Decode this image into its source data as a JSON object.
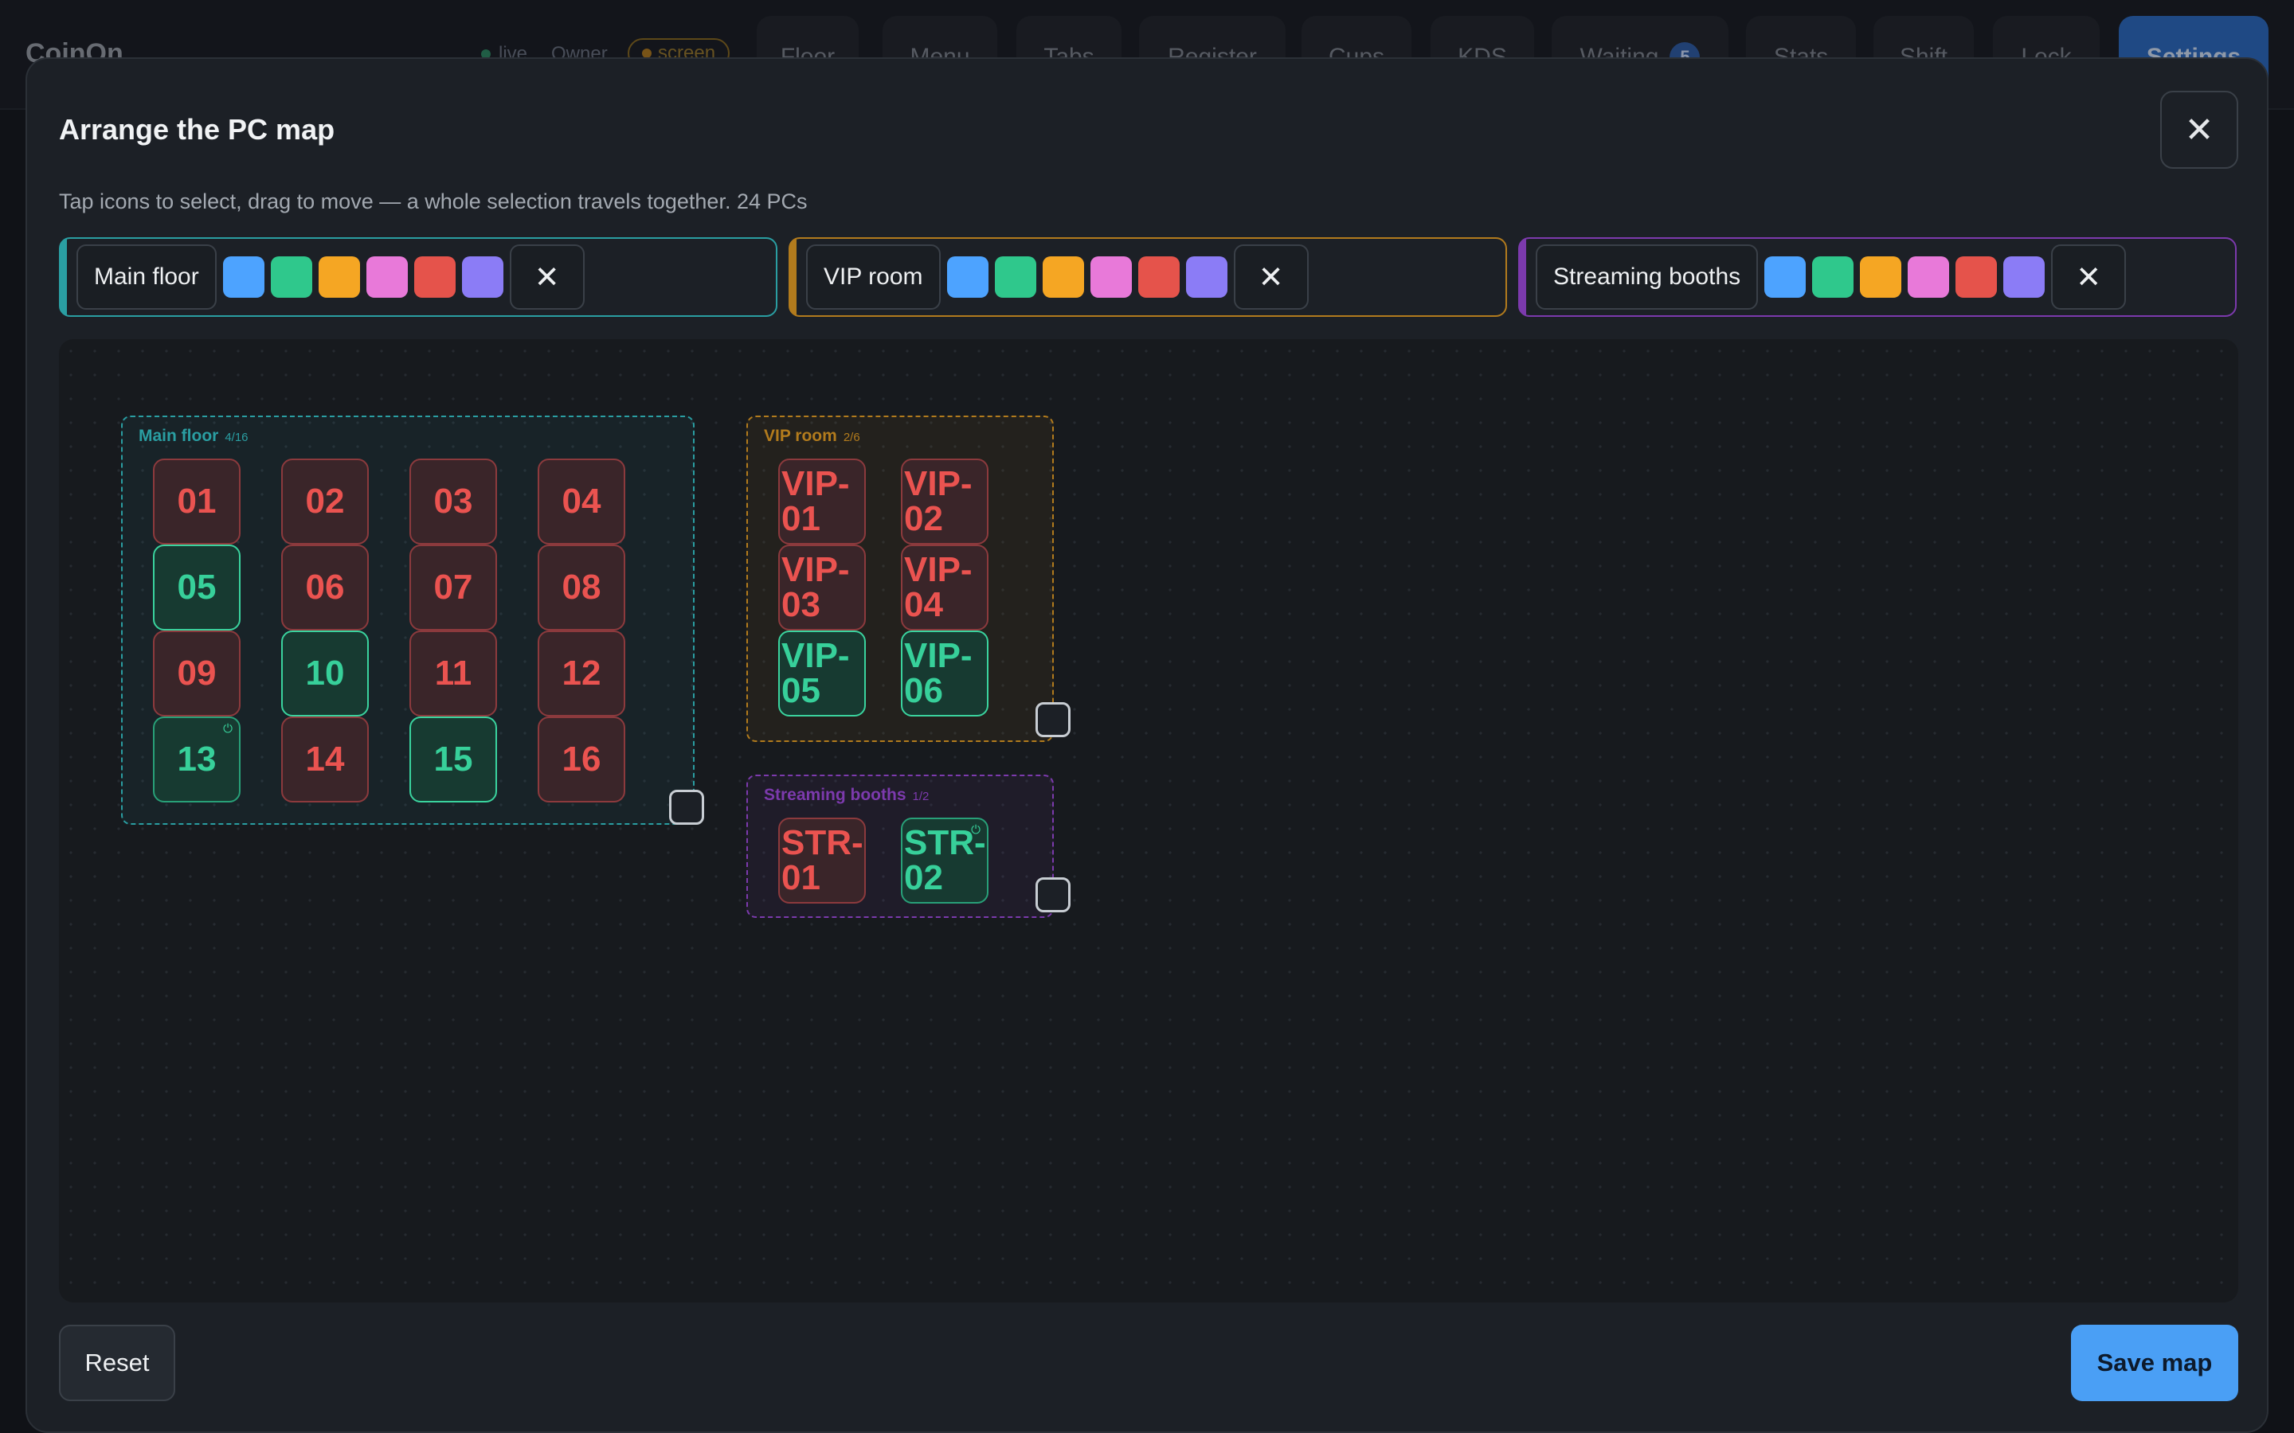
{
  "app": {
    "brand": "CoinOn",
    "status_live": "live",
    "role": "Owner",
    "screen_badge": "screen",
    "nav": [
      {
        "label": "Floor"
      },
      {
        "label": "Menu"
      },
      {
        "label": "Tabs"
      },
      {
        "label": "Register"
      },
      {
        "label": "Cups"
      },
      {
        "label": "KDS"
      },
      {
        "label": "Waiting",
        "badge": "5"
      },
      {
        "label": "Stats"
      },
      {
        "label": "Shift"
      },
      {
        "label": "Lock"
      },
      {
        "label": "Settings",
        "primary": true
      }
    ]
  },
  "modal": {
    "title": "Arrange the PC map",
    "subtitle": "Tap icons to select, drag to move — a whole selection travels together. 24 PCs",
    "close_icon": "close-icon",
    "reset_label": "Reset",
    "save_label": "Save map"
  },
  "palette": [
    "#4da3ff",
    "#2fc88c",
    "#f5a623",
    "#e879d9",
    "#e5534b",
    "#8b7cf6"
  ],
  "zones": [
    {
      "id": "main",
      "name": "Main floor",
      "accent": "#2a9ea2",
      "count": "4/16",
      "pcs": [
        {
          "label": "01",
          "status": "busy"
        },
        {
          "label": "02",
          "status": "busy"
        },
        {
          "label": "03",
          "status": "busy"
        },
        {
          "label": "04",
          "status": "busy"
        },
        {
          "label": "05",
          "status": "free",
          "selected": true
        },
        {
          "label": "06",
          "status": "busy"
        },
        {
          "label": "07",
          "status": "busy"
        },
        {
          "label": "08",
          "status": "busy"
        },
        {
          "label": "09",
          "status": "busy"
        },
        {
          "label": "10",
          "status": "free",
          "selected": true
        },
        {
          "label": "11",
          "status": "busy"
        },
        {
          "label": "12",
          "status": "busy"
        },
        {
          "label": "13",
          "status": "free",
          "power": true
        },
        {
          "label": "14",
          "status": "busy"
        },
        {
          "label": "15",
          "status": "free",
          "selected": true
        },
        {
          "label": "16",
          "status": "busy"
        }
      ]
    },
    {
      "id": "vip",
      "name": "VIP room",
      "accent": "#b27b1d",
      "count": "2/6",
      "pcs": [
        {
          "label": "VIP-01",
          "status": "busy"
        },
        {
          "label": "VIP-02",
          "status": "busy"
        },
        {
          "label": "VIP-03",
          "status": "busy"
        },
        {
          "label": "VIP-04",
          "status": "busy"
        },
        {
          "label": "VIP-05",
          "status": "free",
          "selected": true
        },
        {
          "label": "VIP-06",
          "status": "free",
          "selected": true
        }
      ]
    },
    {
      "id": "stream",
      "name": "Streaming booths",
      "accent": "#7c3aad",
      "count": "1/2",
      "pcs": [
        {
          "label": "STR-01",
          "status": "busy"
        },
        {
          "label": "STR-02",
          "status": "free",
          "power": true
        }
      ]
    }
  ],
  "icons": {
    "close": "close-icon",
    "delete_zone": "close-icon",
    "power": "power-icon",
    "resize": "resize-handle-icon"
  }
}
